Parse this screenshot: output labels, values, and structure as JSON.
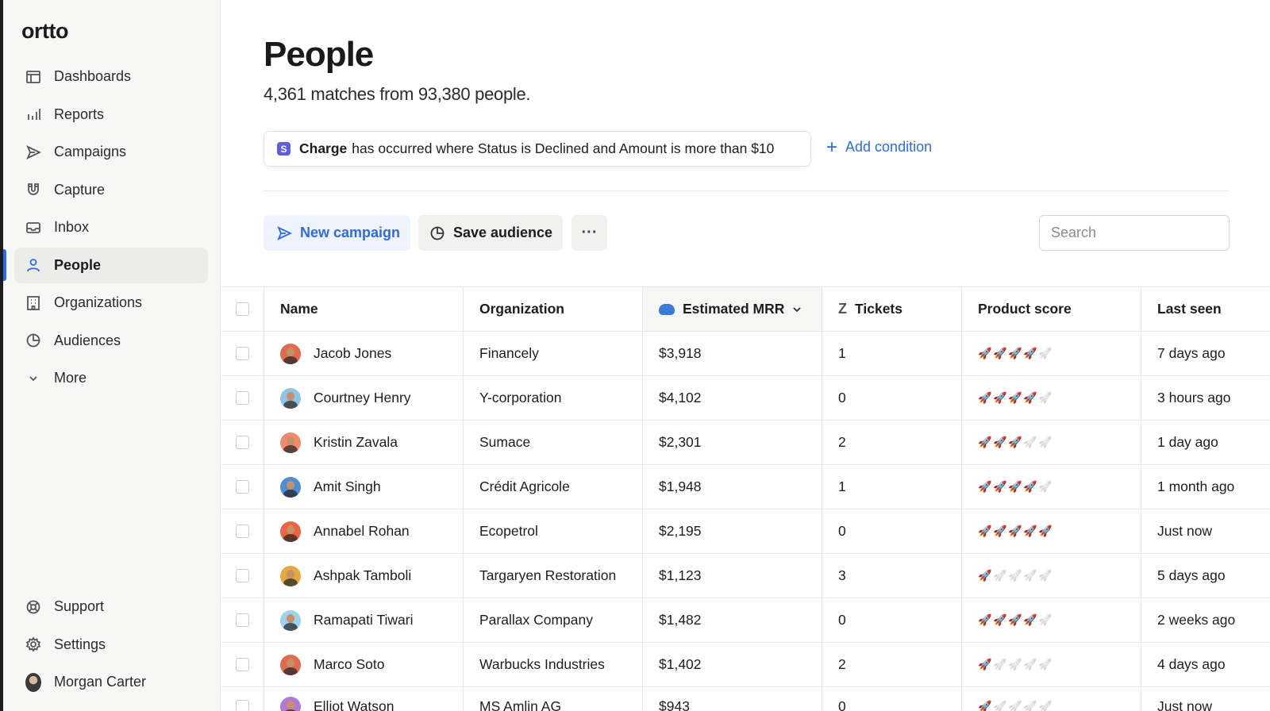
{
  "app": {
    "logo": "ortto"
  },
  "sidebar": {
    "items": [
      {
        "label": "Dashboards",
        "icon": "dashboard-icon"
      },
      {
        "label": "Reports",
        "icon": "bar-chart-icon"
      },
      {
        "label": "Campaigns",
        "icon": "send-icon"
      },
      {
        "label": "Capture",
        "icon": "magnet-icon"
      },
      {
        "label": "Inbox",
        "icon": "inbox-icon"
      },
      {
        "label": "People",
        "icon": "person-icon",
        "active": true
      },
      {
        "label": "Organizations",
        "icon": "building-icon"
      },
      {
        "label": "Audiences",
        "icon": "pie-icon"
      },
      {
        "label": "More",
        "icon": "chevron-down-icon"
      }
    ],
    "bottom": [
      {
        "label": "Support",
        "icon": "lifebuoy-icon"
      },
      {
        "label": "Settings",
        "icon": "gear-icon"
      },
      {
        "label": "Morgan Carter",
        "icon": "avatar"
      }
    ]
  },
  "page": {
    "title": "People",
    "subtitle": "4,361 matches from 93,380 people."
  },
  "filter": {
    "badge": "S",
    "strong": "Charge",
    "text": "has occurred where Status is Declined and Amount is more than $10",
    "add_label": "Add condition"
  },
  "toolbar": {
    "new_campaign": "New campaign",
    "save_audience": "Save audience",
    "more": "···",
    "search_placeholder": "Search"
  },
  "table": {
    "headers": {
      "name": "Name",
      "organization": "Organization",
      "mrr": "Estimated MRR",
      "tickets": "Tickets",
      "score": "Product score",
      "last_seen": "Last seen"
    },
    "rows": [
      {
        "name": "Jacob Jones",
        "org": "Financely",
        "mrr": "$3,918",
        "tickets": "1",
        "score": 4,
        "last_seen": "7 days ago",
        "avatar_color": "#e06b4f"
      },
      {
        "name": "Courtney Henry",
        "org": "Y-corporation",
        "mrr": "$4,102",
        "tickets": "0",
        "score": 4,
        "last_seen": "3 hours ago",
        "avatar_color": "#8fc6e8"
      },
      {
        "name": "Kristin Zavala",
        "org": "Sumace",
        "mrr": "$2,301",
        "tickets": "2",
        "score": 3,
        "last_seen": "1 day ago",
        "avatar_color": "#f08a6c"
      },
      {
        "name": "Amit Singh",
        "org": "Crédit Agricole",
        "mrr": "$1,948",
        "tickets": "1",
        "score": 4,
        "last_seen": "1 month ago",
        "avatar_color": "#4d8fd6"
      },
      {
        "name": "Annabel Rohan",
        "org": "Ecopetrol",
        "mrr": "$2,195",
        "tickets": "0",
        "score": 5,
        "last_seen": "Just now",
        "avatar_color": "#e9643f"
      },
      {
        "name": "Ashpak Tamboli",
        "org": "Targaryen Restoration",
        "mrr": "$1,123",
        "tickets": "3",
        "score": 1,
        "last_seen": "5 days ago",
        "avatar_color": "#e8a93c"
      },
      {
        "name": "Ramapati Tiwari",
        "org": "Parallax Company",
        "mrr": "$1,482",
        "tickets": "0",
        "score": 4,
        "last_seen": "2 weeks ago",
        "avatar_color": "#9fd2ef"
      },
      {
        "name": "Marco Soto",
        "org": "Warbucks Industries",
        "mrr": "$1,402",
        "tickets": "2",
        "score": 1,
        "last_seen": "4 days ago",
        "avatar_color": "#e06b4f"
      },
      {
        "name": "Elliot Watson",
        "org": "MS Amlin AG",
        "mrr": "$943",
        "tickets": "0",
        "score": 1,
        "last_seen": "Just now",
        "avatar_color": "#b07ad6"
      }
    ]
  },
  "colors": {
    "accent": "#2d6be4",
    "stripe": "#5b5fdf",
    "sidebar_bg": "#f7f7f6"
  }
}
